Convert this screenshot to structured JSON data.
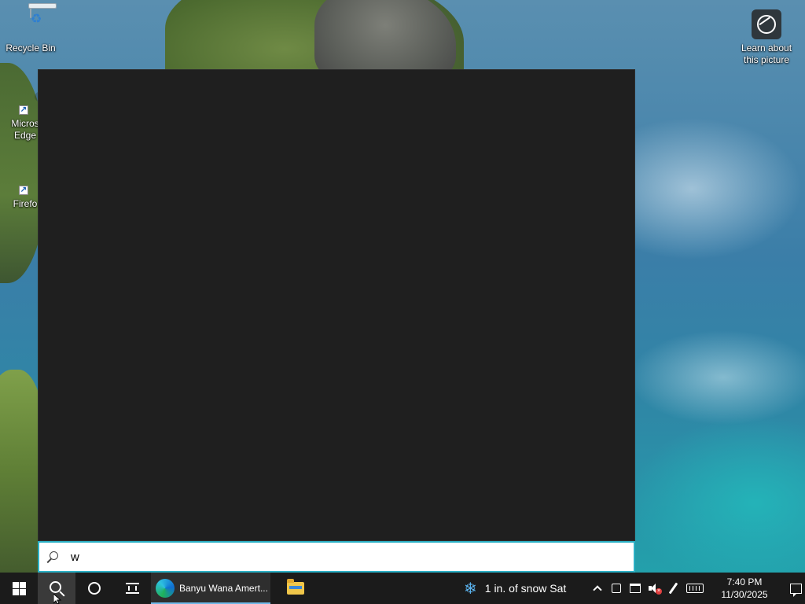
{
  "desktop": {
    "icons": [
      {
        "label": "Recycle Bin",
        "icon": "recycle-bin-icon"
      },
      {
        "label": "Micros\nEdge",
        "icon": "edge-icon"
      },
      {
        "label": "Firefo",
        "icon": "firefox-icon"
      }
    ],
    "spotlight": {
      "label": "Learn about this picture",
      "icon": "learn-about-picture-icon"
    }
  },
  "search": {
    "query": "w",
    "icon": "search-icon"
  },
  "taskbar": {
    "start_icon": "windows-start-icon",
    "search_icon": "search-icon",
    "cortana_icon": "cortana-icon",
    "taskview_icon": "task-view-icon",
    "active_task": {
      "label": "Banyu Wana Amert...",
      "icon": "edge-icon"
    },
    "pinned_explorer_icon": "file-explorer-icon",
    "weather": {
      "text": "1 in. of snow Sat",
      "icon": "snowflake-icon"
    },
    "tray": {
      "icons": [
        "chevron-up-icon",
        "meet-now-icon",
        "network-icon",
        "volume-muted-icon",
        "pen-icon",
        "touch-keyboard-icon"
      ]
    },
    "clock": {
      "time": "7:40 PM",
      "date": "11/30/2025"
    },
    "notification_icon": "action-center-icon"
  },
  "colors": {
    "taskbar": "#1b1b1b",
    "search_panel": "#1f1f1f",
    "search_border": "#2bb0c5",
    "active_indicator": "#6fb8e8"
  }
}
